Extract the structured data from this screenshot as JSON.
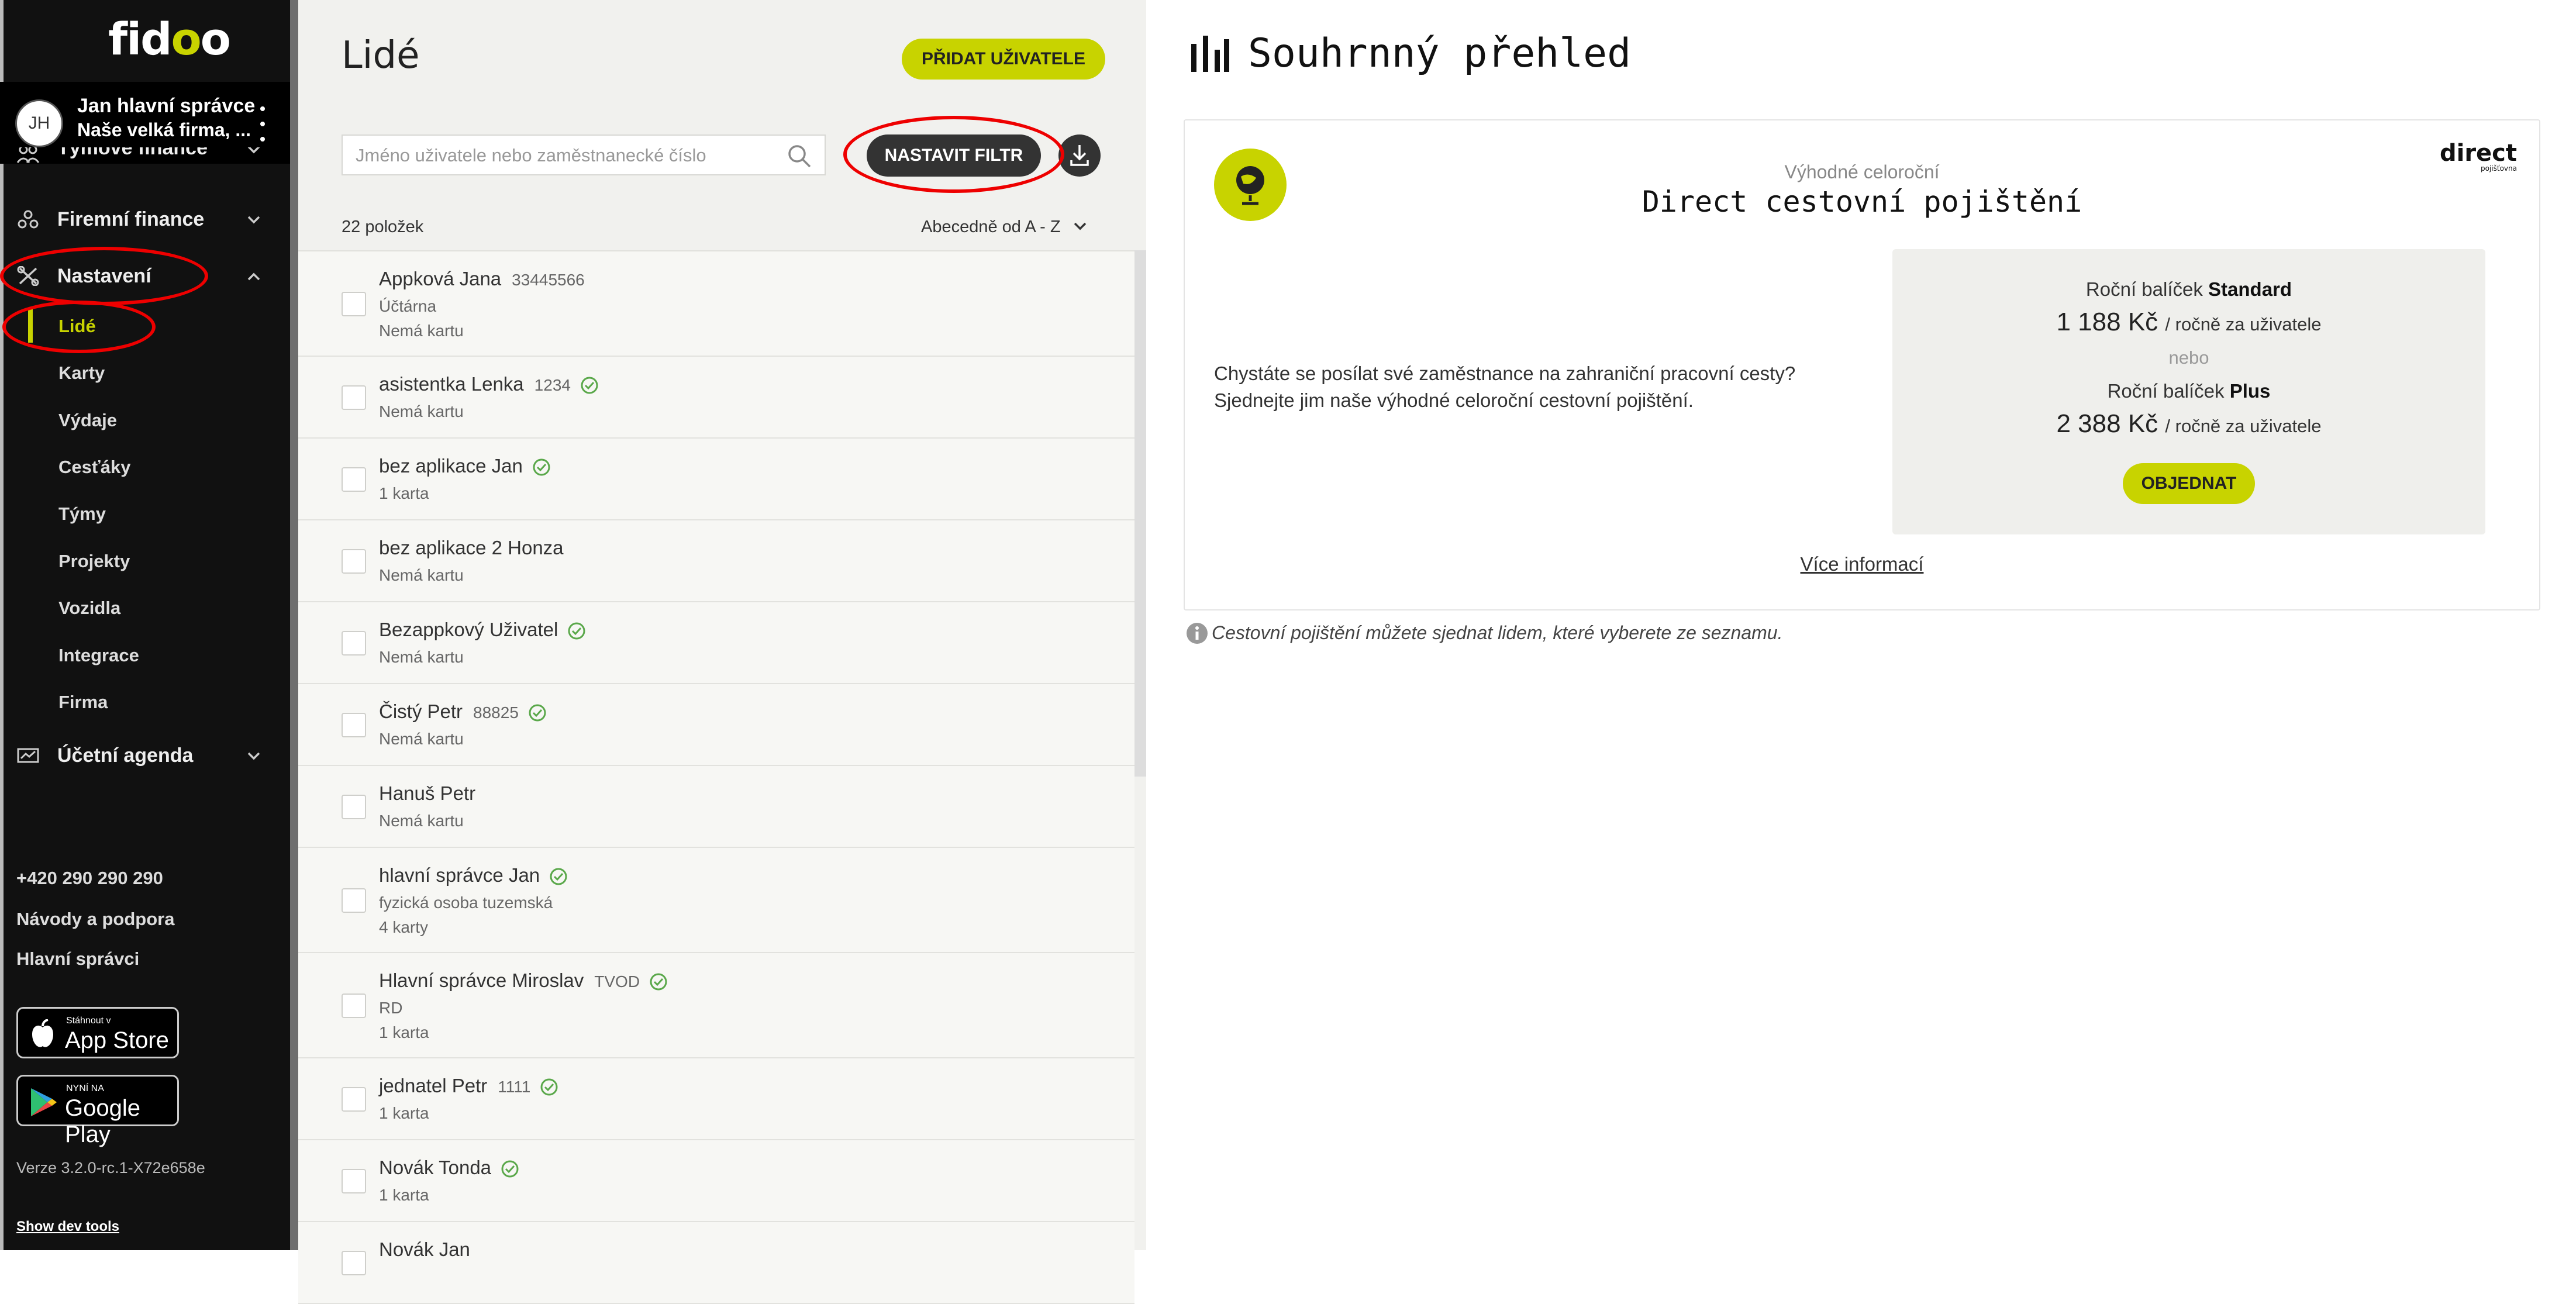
{
  "app": {
    "logo_a": "fid",
    "logo_b": "o",
    "logo_c": "o"
  },
  "user": {
    "initials": "JH",
    "name": "Jan hlavní správce",
    "company": "Naše velká firma, ..."
  },
  "sidebar": {
    "nav": [
      {
        "label": "Týmové finance",
        "icon": "team-icon"
      },
      {
        "label": "Firemní finance",
        "icon": "company-icon"
      },
      {
        "label": "Nastavení",
        "icon": "tools-icon"
      },
      {
        "label": "Účetní agenda",
        "icon": "accounting-icon"
      }
    ],
    "settings_items": [
      "Lidé",
      "Karty",
      "Výdaje",
      "Cesťáky",
      "Týmy",
      "Projekty",
      "Vozidla",
      "Integrace",
      "Firma"
    ],
    "active_item": "Lidé",
    "phone": "+420 290 290 290",
    "help": "Návody a podpora",
    "admins": "Hlavní správci",
    "app_store_small": "Stáhnout v",
    "app_store_big": "App Store",
    "google_play_small": "NYNÍ NA",
    "google_play_big": "Google Play",
    "version": "Verze 3.2.0-rc.1-X72e658e",
    "dev_tools": "Show dev tools"
  },
  "people": {
    "title": "Lidé",
    "add_user_label": "PŘIDAT UŽIVATELE",
    "search_placeholder": "Jméno uživatele nebo zaměstnanecké číslo",
    "filter_label": "NASTAVIT FILTR",
    "count": "22 položek",
    "sort": "Abecedně od A - Z",
    "rows": [
      {
        "name": "Appková Jana",
        "number": "33445566",
        "verified": false,
        "lines": [
          "Účtárna",
          "Nemá kartu"
        ]
      },
      {
        "name": "asistentka Lenka",
        "number": "1234",
        "verified": true,
        "lines": [
          "Nemá kartu"
        ]
      },
      {
        "name": "bez aplikace Jan",
        "number": "",
        "verified": true,
        "lines": [
          "1 karta"
        ]
      },
      {
        "name": "bez aplikace 2 Honza",
        "number": "",
        "verified": false,
        "lines": [
          "Nemá kartu"
        ]
      },
      {
        "name": "Bezappkový Uživatel",
        "number": "",
        "verified": true,
        "lines": [
          "Nemá kartu"
        ]
      },
      {
        "name": "Čistý Petr",
        "number": "88825",
        "verified": true,
        "lines": [
          "Nemá kartu"
        ]
      },
      {
        "name": "Hanuš Petr",
        "number": "",
        "verified": false,
        "lines": [
          "Nemá kartu"
        ]
      },
      {
        "name": "hlavní správce Jan",
        "number": "",
        "verified": true,
        "lines": [
          "fyzická osoba tuzemská",
          "4 karty"
        ]
      },
      {
        "name": "Hlavní správce Miroslav",
        "number": "TVOD",
        "verified": true,
        "lines": [
          "RD",
          "1 karta"
        ]
      },
      {
        "name": "jednatel Petr",
        "number": "1111",
        "verified": true,
        "lines": [
          "1 karta"
        ]
      },
      {
        "name": "Novák Tonda",
        "number": "",
        "verified": true,
        "lines": [
          "1 karta"
        ]
      },
      {
        "name": "Novák Jan",
        "number": "",
        "verified": false,
        "lines": []
      }
    ]
  },
  "summary": {
    "title": "Souhrnný přehled",
    "card_subtitle": "Výhodné celoroční",
    "card_title": "Direct cestovní pojištění",
    "brand_logo": "direct",
    "brand_sub": "pojišťovna",
    "text_line1": "Chystáte se posílat své zaměstnance na zahraniční pracovní cesty?",
    "text_line2": "Sjednejte jim naše výhodné celoroční cestovní pojištění.",
    "pkg_label": "Roční balíček",
    "standard_name": "Standard",
    "standard_price": "1 188 Kč",
    "per_user": "/ ročně za uživatele",
    "or": "nebo",
    "plus_name": "Plus",
    "plus_price": "2 388 Kč",
    "order_label": "OBJEDNAT",
    "more_info": "Více informací",
    "note": "Cestovní pojištění můžete sjednat lidem, které vyberete ze seznamu."
  },
  "colors": {
    "accent": "#c8d300",
    "sidebar_bg": "#111111",
    "highlight_ring": "#ee0000"
  }
}
